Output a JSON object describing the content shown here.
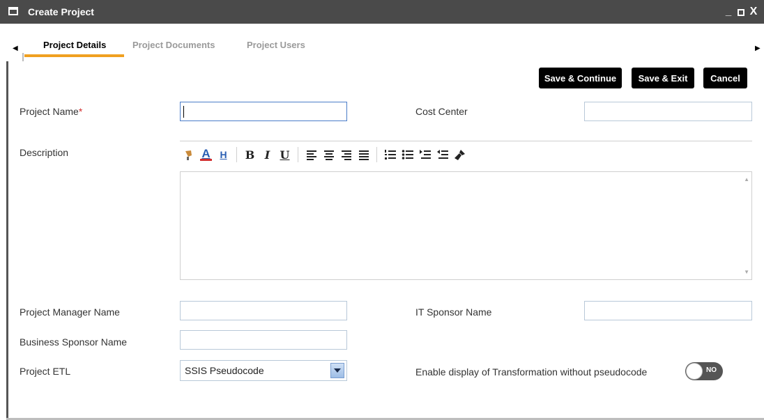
{
  "window": {
    "title": "Create Project",
    "controls": {
      "minimize": "_",
      "close": "X"
    }
  },
  "tabs": [
    {
      "label": "Project Details",
      "active": true
    },
    {
      "label": "Project Documents",
      "active": false
    },
    {
      "label": "Project Users",
      "active": false
    }
  ],
  "tab_nav": {
    "left": "◀",
    "right": "▶"
  },
  "actions": {
    "save_continue": "Save & Continue",
    "save_exit": "Save & Exit",
    "cancel": "Cancel"
  },
  "form": {
    "project_name_label": "Project Name",
    "required_mark": "*",
    "project_name_value": "",
    "cost_center_label": "Cost Center",
    "cost_center_value": "",
    "description_label": "Description",
    "description_value": "",
    "project_manager_label": "Project Manager Name",
    "project_manager_value": "",
    "it_sponsor_label": "IT Sponsor Name",
    "it_sponsor_value": "",
    "business_sponsor_label": "Business Sponsor Name",
    "business_sponsor_value": "",
    "project_etl_label": "Project ETL",
    "project_etl_selected": "SSIS Pseudocode",
    "enable_display_label": "Enable display of Transformation without pseudocode",
    "enable_display_toggle": "NO"
  },
  "editor_toolbar": {
    "bold": "B",
    "italic": "I",
    "underline": "U",
    "font_color": "A",
    "highlight": "H"
  },
  "colors": {
    "titlebar": "#4a4a4a",
    "active_tab_underline": "#f0a020",
    "button_bg": "#000000",
    "required": "#d32f2f"
  }
}
